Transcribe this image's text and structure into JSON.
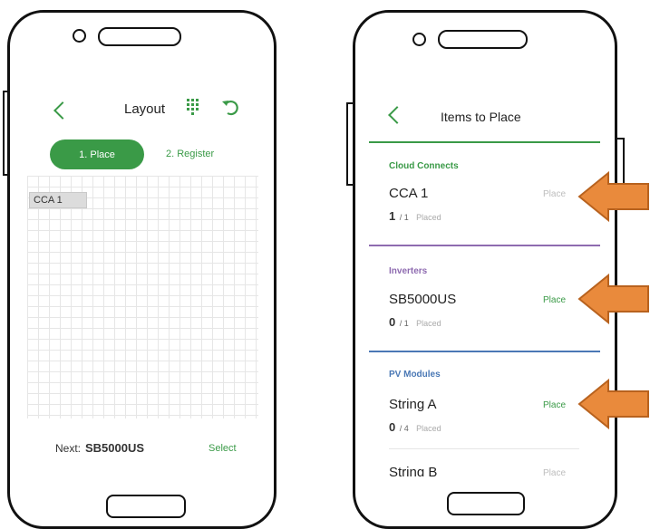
{
  "left_screen": {
    "header": {
      "title": "Layout"
    },
    "tabs": [
      {
        "label": "1. Place",
        "active": true
      },
      {
        "label": "2. Register",
        "active": false
      }
    ],
    "canvas": {
      "placed_chip": "CCA 1"
    },
    "footer": {
      "next_prefix": "Next:",
      "next_item": "SB5000US",
      "select_label": "Select"
    }
  },
  "right_screen": {
    "header": {
      "title": "Items to Place"
    },
    "sections": [
      {
        "title": "Cloud Connects",
        "color": "#3a9a47",
        "items": [
          {
            "name": "CCA 1",
            "placed": "1",
            "total": "/ 1",
            "status": "Placed",
            "action": "Place",
            "action_enabled": false
          }
        ]
      },
      {
        "title": "Inverters",
        "color": "#8e6bb0",
        "items": [
          {
            "name": "SB5000US",
            "placed": "0",
            "total": "/ 1",
            "status": "Placed",
            "action": "Place",
            "action_enabled": true
          }
        ]
      },
      {
        "title": "PV Modules",
        "color": "#4a78b5",
        "items": [
          {
            "name": "String A",
            "placed": "0",
            "total": "/ 4",
            "status": "Placed",
            "action": "Place",
            "action_enabled": true
          },
          {
            "name": "String B",
            "action": "Place"
          }
        ]
      }
    ]
  },
  "colors": {
    "accent_green": "#3a9a47",
    "arrow_orange": "#e98a3c",
    "arrow_border": "#b8621e"
  },
  "icons": [
    "back-chevron-icon",
    "keypad-icon",
    "undo-icon",
    "arrow-callout-icon"
  ]
}
